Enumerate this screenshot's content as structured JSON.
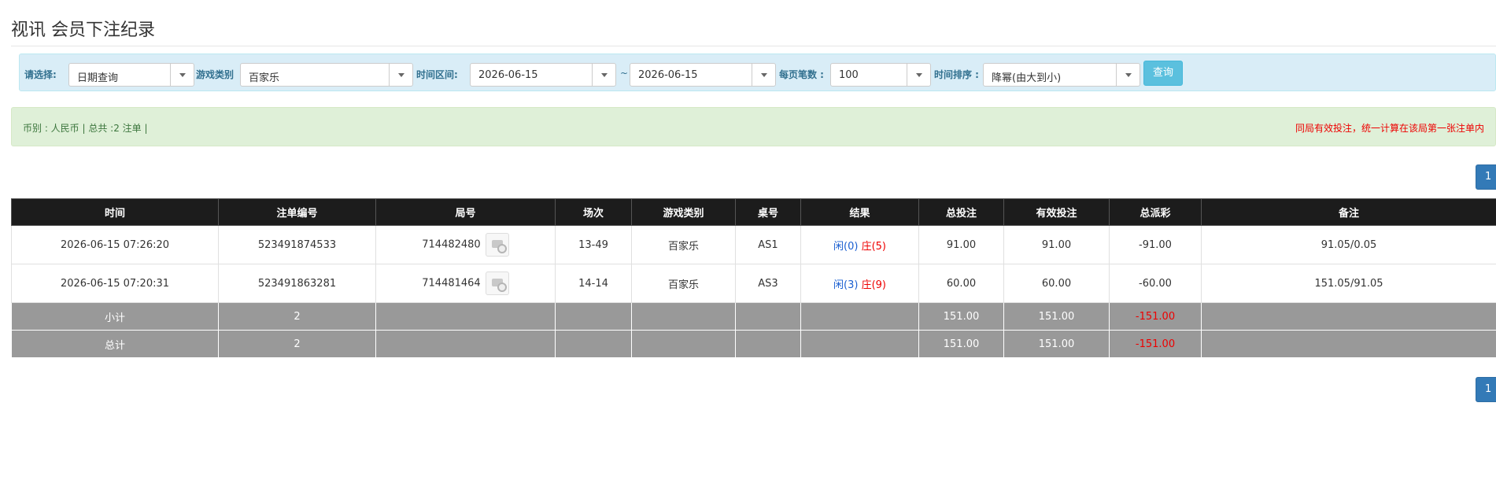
{
  "page_title": "视讯 会员下注纪录",
  "filters": {
    "select_label": "请选择:",
    "date_query_value": "日期查询",
    "game_type_label": "游戏类别",
    "game_type_value": "百家乐",
    "time_range_label": "时间区间:",
    "date_from": "2026-06-15",
    "tilde": "~",
    "date_to": "2026-06-15",
    "per_page_label": "每页笔数 :",
    "per_page_value": "100",
    "sort_label": "时间排序 :",
    "sort_value": "降幂(由大到小)",
    "query_button": "查询"
  },
  "info": {
    "left_text": "币别 : 人民币 | 总共 :2 注单 |",
    "right_text": "同局有效投注，统一计算在该局第一张注单内"
  },
  "pagination": {
    "current_page": "1"
  },
  "table": {
    "headers": [
      "时间",
      "注单编号",
      "局号",
      "场次",
      "游戏类别",
      "桌号",
      "结果",
      "总投注",
      "有效投注",
      "总派彩",
      "备注"
    ],
    "rows": [
      {
        "time": "2026-06-15 07:26:20",
        "bet_id": "523491874533",
        "round_id": "714482480",
        "session": "13-49",
        "game_type": "百家乐",
        "table_no": "AS1",
        "result_player": "闲(0)",
        "result_banker": "庄(5)",
        "total_bet": "91.00",
        "valid_bet": "91.00",
        "payout": "-91.00",
        "remark": "91.05/0.05"
      },
      {
        "time": "2026-06-15 07:20:31",
        "bet_id": "523491863281",
        "round_id": "714481464",
        "session": "14-14",
        "game_type": "百家乐",
        "table_no": "AS3",
        "result_player": "闲(3)",
        "result_banker": "庄(9)",
        "total_bet": "60.00",
        "valid_bet": "60.00",
        "payout": "-60.00",
        "remark": "151.05/91.05"
      }
    ],
    "subtotal": {
      "label": "小计",
      "count": "2",
      "total_bet": "151.00",
      "valid_bet": "151.00",
      "payout": "-151.00"
    },
    "grand_total": {
      "label": "总计",
      "count": "2",
      "total_bet": "151.00",
      "valid_bet": "151.00",
      "payout": "-151.00"
    }
  },
  "colors": {
    "header_bg": "#1c1c1c",
    "summary_bg": "#999999",
    "filter_bg": "#d9edf7",
    "info_bg": "#dff0d8",
    "accent_blue": "#1a5fd1",
    "negative_red": "#ee0000"
  },
  "icons": {
    "round_detail": "round-detail-icon",
    "select_caret": "chevron-down-icon"
  }
}
